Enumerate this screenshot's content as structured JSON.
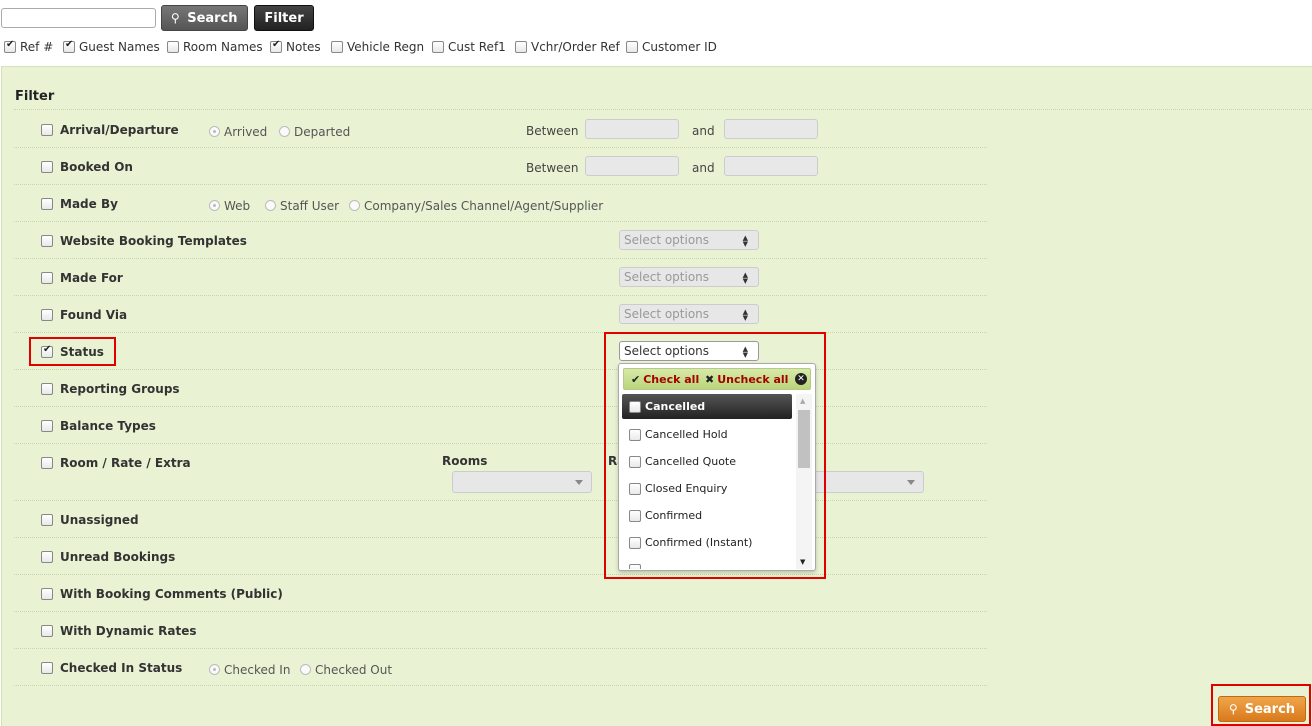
{
  "top": {
    "search_value": "",
    "search_button": "Search",
    "filter_button": "Filter"
  },
  "columns": [
    {
      "label": "Ref #",
      "checked": true
    },
    {
      "label": "Guest Names",
      "checked": true
    },
    {
      "label": "Room Names",
      "checked": false
    },
    {
      "label": "Notes",
      "checked": true
    },
    {
      "label": "Vehicle Regn",
      "checked": false
    },
    {
      "label": "Cust Ref1",
      "checked": false
    },
    {
      "label": "Vchr/Order Ref",
      "checked": false
    },
    {
      "label": "Customer ID",
      "checked": false
    }
  ],
  "filter": {
    "title": "Filter",
    "between_label": "Between",
    "and_label": "and",
    "select_placeholder": "Select options",
    "rows": {
      "arrival": {
        "label": "Arrival/Departure",
        "opt1": "Arrived",
        "opt2": "Departed"
      },
      "booked_on": {
        "label": "Booked On"
      },
      "made_by": {
        "label": "Made By",
        "opt1": "Web",
        "opt2": "Staff User",
        "opt3": "Company/Sales Channel/Agent/Supplier"
      },
      "website_templates": {
        "label": "Website Booking Templates"
      },
      "made_for": {
        "label": "Made For"
      },
      "found_via": {
        "label": "Found Via"
      },
      "status": {
        "label": "Status",
        "checked": true
      },
      "reporting_groups": {
        "label": "Reporting Groups"
      },
      "balance_types": {
        "label": "Balance Types"
      },
      "room_rate_extra": {
        "label": "Room / Rate / Extra",
        "rooms_heading": "Rooms",
        "rate_heading": "Ra"
      },
      "unassigned": {
        "label": "Unassigned"
      },
      "unread": {
        "label": "Unread Bookings"
      },
      "comments": {
        "label": "With Booking Comments (Public)"
      },
      "dynamic_rates": {
        "label": "With Dynamic Rates"
      },
      "checked_in": {
        "label": "Checked In Status",
        "opt1": "Checked In",
        "opt2": "Checked Out"
      }
    }
  },
  "status_dropdown": {
    "check_all": "Check all",
    "uncheck_all": "Uncheck all",
    "options": [
      "Cancelled",
      "Cancelled Hold",
      "Cancelled Quote",
      "Closed Enquiry",
      "Confirmed",
      "Confirmed (Instant)"
    ],
    "highlighted": "Cancelled"
  },
  "bottom": {
    "search_button": "Search"
  },
  "colors": {
    "panel_bg": "#e9f3d4",
    "highlight_red": "#e00000",
    "search_orange": "#e08a2c",
    "dropdown_header": "#c6df8f",
    "action_red": "#a40000"
  }
}
